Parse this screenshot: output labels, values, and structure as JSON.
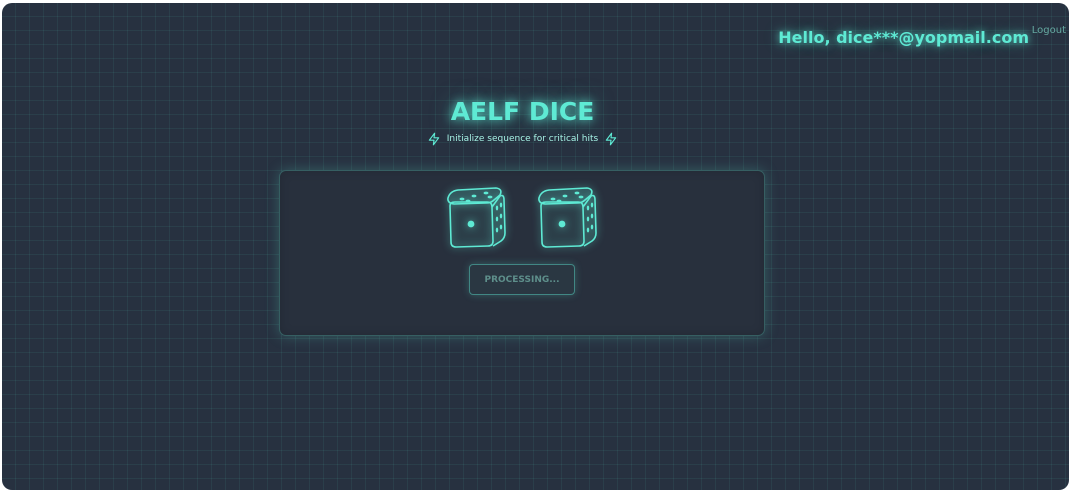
{
  "header": {
    "greeting": "Hello, dice***@yopmail.com",
    "logout_label": "Logout"
  },
  "main": {
    "title": "AELF DICE",
    "subtitle": "Initialize sequence for critical hits",
    "subtitle_icon": "lightning-bolt-icon"
  },
  "game": {
    "dice": [
      {
        "icon": "dice-icon",
        "face_value": 1
      },
      {
        "icon": "dice-icon",
        "face_value": 1
      }
    ],
    "roll_button_label": "PROCESSING...",
    "roll_button_state": "disabled"
  },
  "theme": {
    "accent": "#5eead4",
    "background": "#273140",
    "panel": "#28303d"
  }
}
